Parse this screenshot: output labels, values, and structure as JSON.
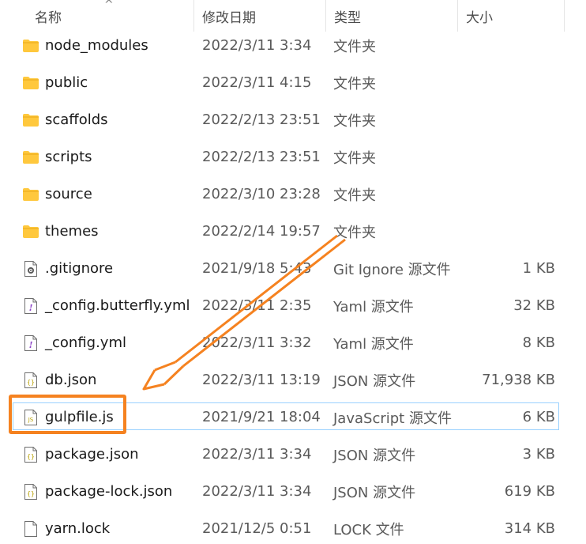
{
  "header": {
    "name_label": "名称",
    "date_label": "修改日期",
    "type_label": "类型",
    "size_label": "大小",
    "sort_indicator": "^"
  },
  "colors": {
    "folder": "#ffc83d",
    "folder_dark": "#e8a917",
    "selection_border": "#99d1ff",
    "highlight": "#f58220",
    "text_secondary": "#5a5a5a"
  },
  "files": [
    {
      "name": "node_modules",
      "date": "2022/3/11 3:34",
      "type": "文件夹",
      "size": "",
      "icon": "folder-icon"
    },
    {
      "name": "public",
      "date": "2022/3/11 4:15",
      "type": "文件夹",
      "size": "",
      "icon": "folder-icon"
    },
    {
      "name": "scaffolds",
      "date": "2022/2/13 23:51",
      "type": "文件夹",
      "size": "",
      "icon": "folder-icon"
    },
    {
      "name": "scripts",
      "date": "2022/2/13 23:51",
      "type": "文件夹",
      "size": "",
      "icon": "folder-icon"
    },
    {
      "name": "source",
      "date": "2022/3/10 23:28",
      "type": "文件夹",
      "size": "",
      "icon": "folder-icon"
    },
    {
      "name": "themes",
      "date": "2022/2/14 19:57",
      "type": "文件夹",
      "size": "",
      "icon": "folder-icon"
    },
    {
      "name": ".gitignore",
      "date": "2021/9/18 5:43",
      "type": "Git Ignore 源文件",
      "size": "1 KB",
      "icon": "gear-file-icon"
    },
    {
      "name": "_config.butterfly.yml",
      "date": "2022/3/11 2:35",
      "type": "Yaml 源文件",
      "size": "32 KB",
      "icon": "yaml-file-icon"
    },
    {
      "name": "_config.yml",
      "date": "2022/3/11 3:32",
      "type": "Yaml 源文件",
      "size": "8 KB",
      "icon": "yaml-file-icon"
    },
    {
      "name": "db.json",
      "date": "2022/3/11 13:19",
      "type": "JSON 源文件",
      "size": "71,938 KB",
      "icon": "json-file-icon"
    },
    {
      "name": "gulpfile.js",
      "date": "2021/9/21 18:04",
      "type": "JavaScript 源文件",
      "size": "6 KB",
      "icon": "js-file-icon"
    },
    {
      "name": "package.json",
      "date": "2022/3/11 3:34",
      "type": "JSON 源文件",
      "size": "3 KB",
      "icon": "json-file-icon"
    },
    {
      "name": "package-lock.json",
      "date": "2022/3/11 3:34",
      "type": "JSON 源文件",
      "size": "619 KB",
      "icon": "json-file-icon"
    },
    {
      "name": "yarn.lock",
      "date": "2021/12/5 0:51",
      "type": "LOCK 文件",
      "size": "314 KB",
      "icon": "blank-file-icon"
    }
  ]
}
